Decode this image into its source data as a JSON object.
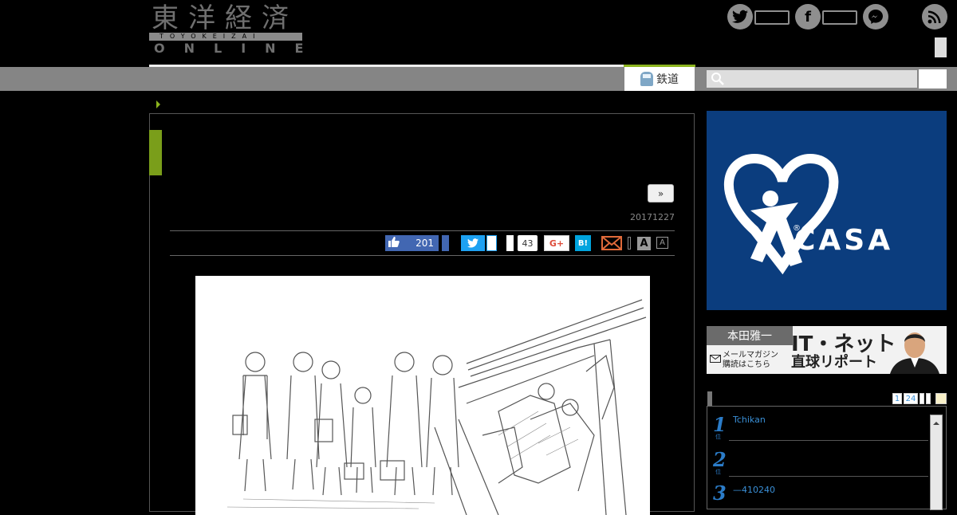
{
  "header": {
    "logo_kanji": "東洋経済",
    "logo_sub": "TOYOKEIZAI",
    "logo_online": "ONLINE"
  },
  "nav": {
    "tab_label": "鉄道",
    "search_placeholder": ""
  },
  "article": {
    "next_label": "»",
    "date": "20171227",
    "like_count": "201",
    "share_count": "43",
    "gplus_label": "G+",
    "hatena_label": "B!",
    "font_large": "A",
    "font_small": "A"
  },
  "sidebar": {
    "ad_brand": "CASA",
    "ad_registered": "®",
    "banner_name": "本田雅一",
    "banner_title": "IT・ネット",
    "banner_subtitle": "直球リポート",
    "banner_mail_line1": "メールマガジン",
    "banner_mail_line2": "購読はこちら",
    "ranking": {
      "pages": [
        "1",
        "24"
      ],
      "items": [
        {
          "rank": "1",
          "unit": "位",
          "text": "Tchikan"
        },
        {
          "rank": "2",
          "unit": "位",
          "text": ""
        },
        {
          "rank": "3",
          "unit": "位",
          "text": "—410240"
        }
      ]
    }
  },
  "colors": {
    "accent_green": "#8cb41e",
    "casa_blue": "#0b3d7e",
    "facebook": "#4267b2",
    "twitter": "#1da1f2",
    "hatena": "#00a4de",
    "ranking_blue": "#2b7cc8"
  }
}
